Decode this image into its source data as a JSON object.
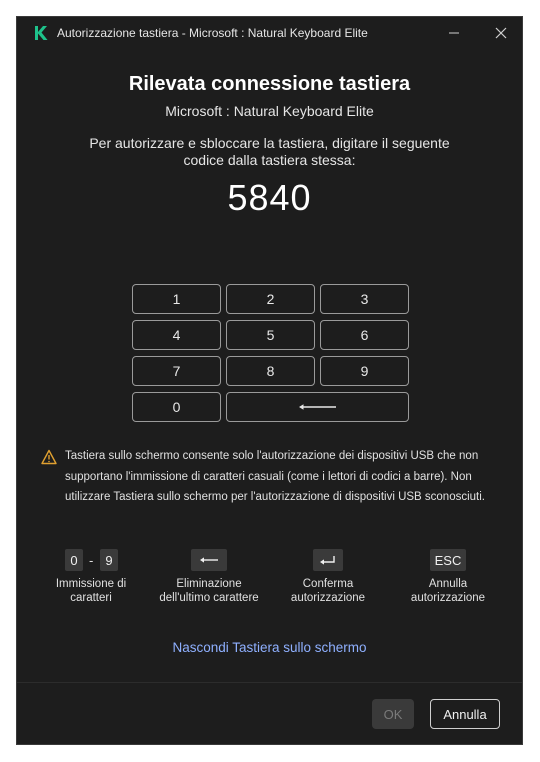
{
  "window": {
    "title": "Autorizzazione tastiera - Microsoft : Natural Keyboard Elite",
    "logo": "kaspersky-k-logo",
    "accent_color": "#1ec28b"
  },
  "main": {
    "heading": "Rilevata connessione tastiera",
    "device": "Microsoft : Natural Keyboard Elite",
    "instructions": "Per autorizzare e sbloccare la tastiera, digitare il seguente codice dalla tastiera stessa:",
    "code": "5840"
  },
  "keypad": {
    "keys": [
      "1",
      "2",
      "3",
      "4",
      "5",
      "6",
      "7",
      "8",
      "9",
      "0"
    ],
    "backspace_icon": "long-left-arrow-icon"
  },
  "warning": {
    "icon": "warning-triangle-icon",
    "color": "#e0a030",
    "text": "Tastiera sullo schermo consente solo l'autorizzazione dei dispositivi USB che non supportano l'immissione di caratteri casuali (come i lettori di codici a barre). Non utilizzare Tastiera sullo schermo per l'autorizzazione di dispositivi USB sconosciuti."
  },
  "legend": {
    "input": {
      "from": "0",
      "sep": "-",
      "to": "9",
      "label": "Immissione di caratteri"
    },
    "delete": {
      "icon": "backspace-arrow-icon",
      "label": "Eliminazione dell'ultimo carattere"
    },
    "confirm": {
      "icon": "enter-arrow-icon",
      "label": "Conferma autorizzazione"
    },
    "cancel": {
      "key": "ESC",
      "label": "Annulla autorizzazione"
    }
  },
  "hide_link": "Nascondi Tastiera sullo schermo",
  "footer": {
    "ok_label": "OK",
    "cancel_label": "Annulla"
  }
}
